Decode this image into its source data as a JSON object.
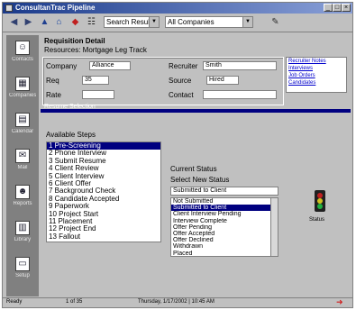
{
  "window": {
    "title": "ConsultanTrac Pipeline",
    "min_label": "_",
    "max_label": "□",
    "close_label": "×"
  },
  "toolbar": {
    "type_value": "Search Results",
    "filter_value": "All Companies"
  },
  "sidebar": {
    "items": [
      {
        "label": "Contacts"
      },
      {
        "label": "Companies"
      },
      {
        "label": "Calendar"
      },
      {
        "label": "Mail"
      },
      {
        "label": "Reports"
      },
      {
        "label": "Library"
      },
      {
        "label": "Setup"
      }
    ]
  },
  "details": {
    "heading": "Requisition Detail",
    "subheading": "Resources: Mortgage Leg Track",
    "company_label": "Company",
    "company_value": "Alliance",
    "reqs_label": "Req",
    "reqs_value": "35",
    "rate_label": "Rate",
    "rate_value": "",
    "owner_label": "Recruiter",
    "owner_value": "Smith",
    "source_label": "Source",
    "source_value": "Hired",
    "contact_label": "Contact",
    "contact_value": ""
  },
  "links": {
    "items": [
      "Recruiter Notes",
      "Interviews",
      "Job Orders",
      "Candidates"
    ]
  },
  "section": {
    "title": "Resume Selection",
    "list_label": "Available Steps"
  },
  "steps_list": {
    "items": [
      "1 Pre-Screening",
      "2 Phone Interview",
      "3 Submit Resume",
      "4 Client Review",
      "5 Client Interview",
      "6 Client Offer",
      "7 Background Check",
      "8 Candidate Accepted",
      "9 Paperwork",
      "10 Project Start",
      "11 Placement",
      "12 Project End",
      "13 Fallout"
    ],
    "selected_index": 0
  },
  "status_panel": {
    "label": "Current Status",
    "sublabel": "Select New Status",
    "select_value": "Submitted to Client",
    "items": [
      "Not Submitted",
      "Submitted to Client",
      "Client Interview Pending",
      "Interview Complete",
      "Offer Pending",
      "Offer Accepted",
      "Offer Declined",
      "Withdrawn",
      "Placed"
    ],
    "selected_index": 1
  },
  "traffic_light": {
    "label": "Status"
  },
  "statusbar": {
    "left": "Ready",
    "record": "1 of 35",
    "date": "Thursday, 1/17/2002 | 10:45 AM"
  }
}
